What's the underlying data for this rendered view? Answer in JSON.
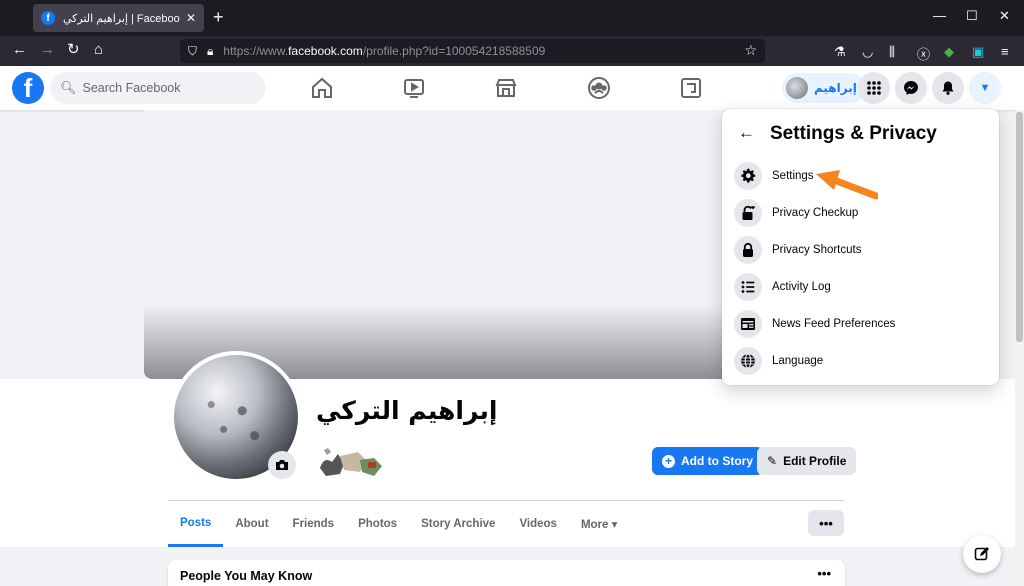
{
  "browser": {
    "tab_title": "إبراهيم التركي | Facebook",
    "tab_close": "✕",
    "new_tab": "+",
    "url_prefix": "https://www.",
    "url_domain": "facebook.com",
    "url_suffix": "/profile.php?id=100054218588509",
    "window_controls": [
      "—",
      "☐",
      "✕"
    ]
  },
  "header": {
    "search_placeholder": "Search Facebook",
    "profile_chip_name": "إبراهيم",
    "brand_color": "#1877f2"
  },
  "profile": {
    "name": "إبراهيم التركي",
    "add_story_label": "Add to Story",
    "edit_profile_label": "Edit Profile",
    "tabs": [
      {
        "label": "Posts",
        "active": true
      },
      {
        "label": "About"
      },
      {
        "label": "Friends"
      },
      {
        "label": "Photos"
      },
      {
        "label": "Story Archive"
      },
      {
        "label": "Videos"
      },
      {
        "label": "More ▾"
      }
    ],
    "more_options": "•••",
    "people_you_may_know": "People You May Know"
  },
  "settings_menu": {
    "back_icon": "←",
    "title": "Settings & Privacy",
    "items": [
      {
        "label": "Settings",
        "icon": "gear-icon"
      },
      {
        "label": "Privacy Checkup",
        "icon": "lock-heart-icon"
      },
      {
        "label": "Privacy Shortcuts",
        "icon": "lock-icon"
      },
      {
        "label": "Activity Log",
        "icon": "list-icon"
      },
      {
        "label": "News Feed Preferences",
        "icon": "news-feed-icon"
      },
      {
        "label": "Language",
        "icon": "globe-icon"
      }
    ],
    "annotation_arrow_color": "#f5861f"
  }
}
